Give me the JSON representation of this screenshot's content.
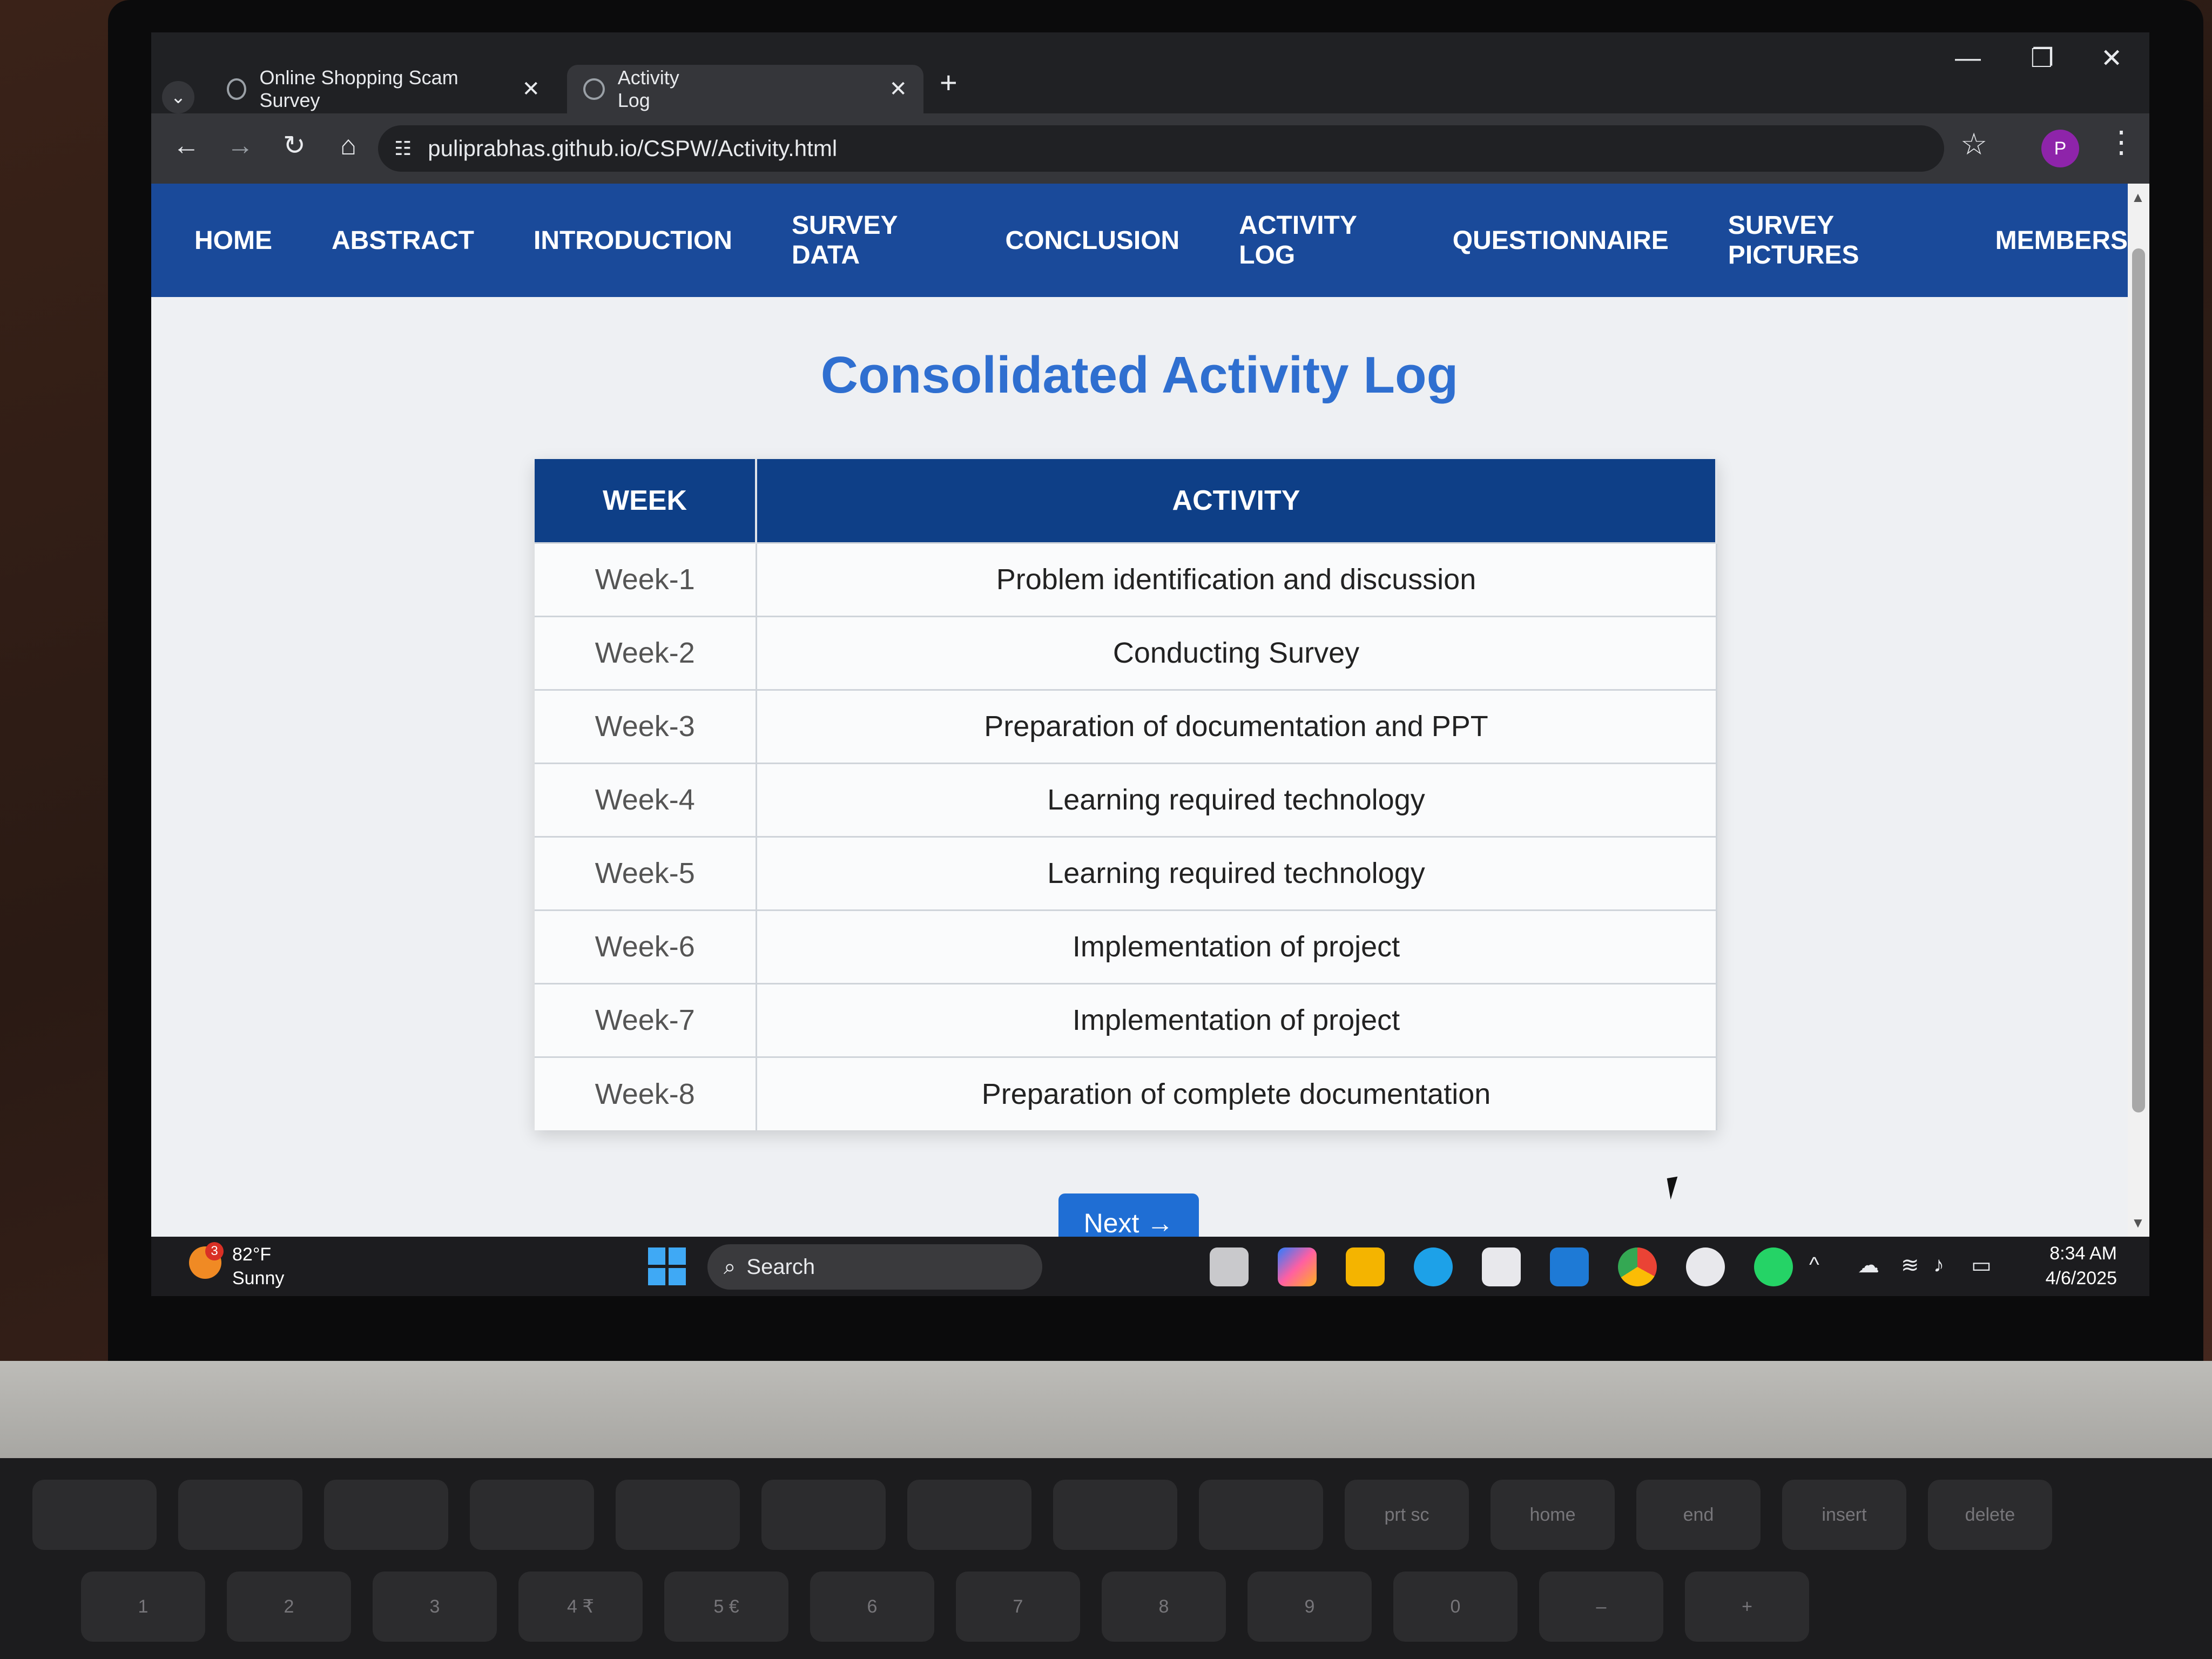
{
  "browser": {
    "tabs": [
      {
        "label": "Online Shopping Scam Survey",
        "active": false
      },
      {
        "label": "Activity Log",
        "active": true
      }
    ],
    "url": "puliprabhas.github.io/CSPW/Activity.html",
    "profile_initial": "P"
  },
  "site": {
    "nav": [
      "HOME",
      "ABSTRACT",
      "INTRODUCTION",
      "SURVEY DATA",
      "CONCLUSION",
      "ACTIVITY LOG",
      "QUESTIONNAIRE",
      "SURVEY PICTURES",
      "MEMBERS"
    ],
    "heading": "Consolidated Activity Log",
    "table": {
      "headers": [
        "WEEK",
        "ACTIVITY"
      ],
      "rows": [
        {
          "week": "Week-1",
          "activity": "Problem identification and discussion"
        },
        {
          "week": "Week-2",
          "activity": "Conducting Survey"
        },
        {
          "week": "Week-3",
          "activity": "Preparation of documentation and PPT"
        },
        {
          "week": "Week-4",
          "activity": "Learning required technology"
        },
        {
          "week": "Week-5",
          "activity": "Learning required technology"
        },
        {
          "week": "Week-6",
          "activity": "Implementation of project"
        },
        {
          "week": "Week-7",
          "activity": "Implementation of project"
        },
        {
          "week": "Week-8",
          "activity": "Preparation of complete documentation"
        }
      ]
    },
    "next_label": "Next →"
  },
  "taskbar": {
    "weather_badge": "3",
    "weather_temp": "82°F",
    "weather_cond": "Sunny",
    "search_placeholder": "Search",
    "time": "8:34 AM",
    "date": "4/6/2025"
  },
  "keyboard": {
    "row1": [
      "",
      "",
      "",
      "",
      "",
      "",
      "",
      "",
      "",
      "prt sc",
      "home",
      "end",
      "insert",
      "delete"
    ],
    "row2": [
      "1",
      "2",
      "3",
      "4 ₹",
      "5 €",
      "6",
      "7",
      "8",
      "9",
      "0",
      "–",
      "+"
    ]
  },
  "colors": {
    "nav_bg": "#1a4a9a",
    "header_bg": "#0e3f87",
    "accent": "#2f6fd0",
    "button": "#1f6ed4"
  }
}
